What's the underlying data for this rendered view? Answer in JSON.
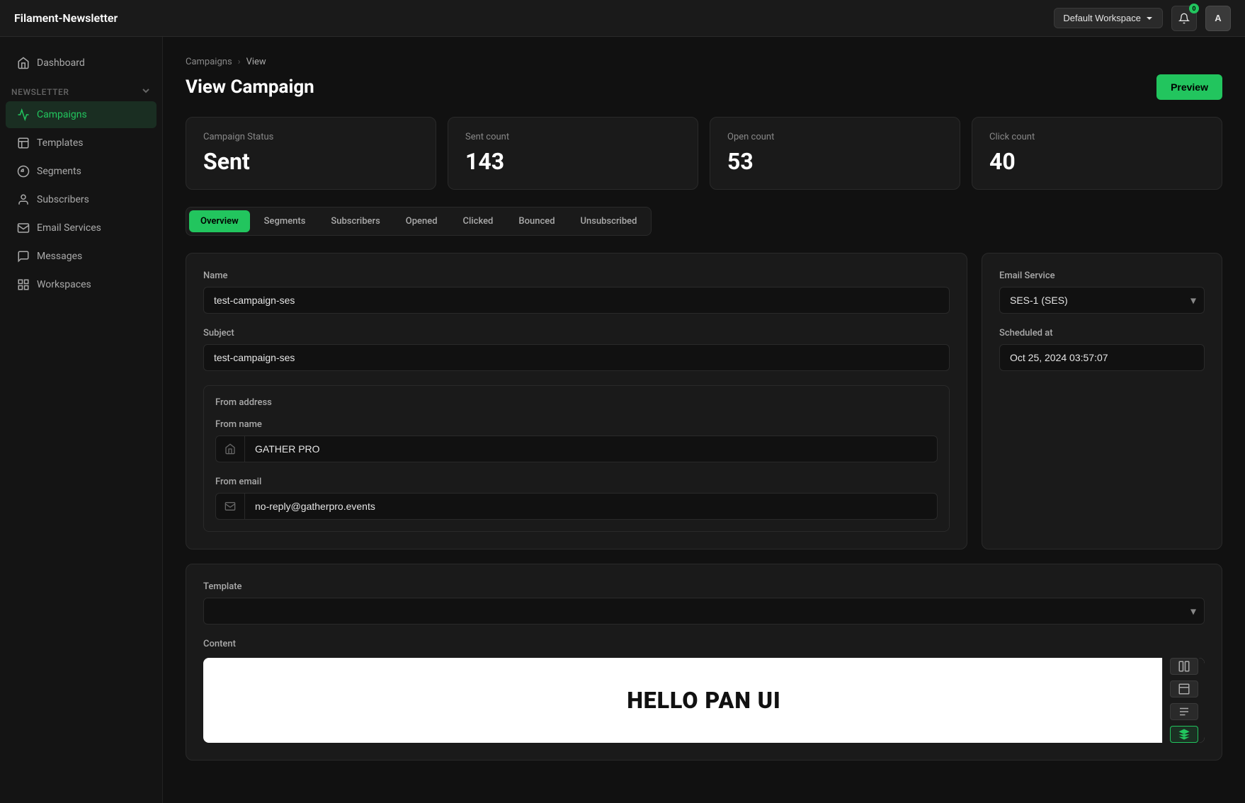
{
  "app": {
    "title": "Filament-Newsletter"
  },
  "topbar": {
    "workspace_label": "Default Workspace",
    "notification_count": "0",
    "avatar_label": "A"
  },
  "sidebar": {
    "section_label": "Newsletter",
    "items": [
      {
        "id": "dashboard",
        "label": "Dashboard",
        "icon": "home-icon",
        "active": false
      },
      {
        "id": "campaigns",
        "label": "Campaigns",
        "icon": "campaigns-icon",
        "active": true
      },
      {
        "id": "templates",
        "label": "Templates",
        "icon": "templates-icon",
        "active": false
      },
      {
        "id": "segments",
        "label": "Segments",
        "icon": "segments-icon",
        "active": false
      },
      {
        "id": "subscribers",
        "label": "Subscribers",
        "icon": "subscribers-icon",
        "active": false
      },
      {
        "id": "email-services",
        "label": "Email Services",
        "icon": "email-services-icon",
        "active": false
      },
      {
        "id": "messages",
        "label": "Messages",
        "icon": "messages-icon",
        "active": false
      },
      {
        "id": "workspaces",
        "label": "Workspaces",
        "icon": "workspaces-icon",
        "active": false
      }
    ]
  },
  "breadcrumb": {
    "parent": "Campaigns",
    "separator": "›",
    "current": "View"
  },
  "page": {
    "title": "View Campaign",
    "preview_button": "Preview"
  },
  "stats": [
    {
      "label": "Campaign Status",
      "value": "Sent"
    },
    {
      "label": "Sent count",
      "value": "143"
    },
    {
      "label": "Open count",
      "value": "53"
    },
    {
      "label": "Click count",
      "value": "40"
    }
  ],
  "tabs": [
    {
      "id": "overview",
      "label": "Overview",
      "active": true
    },
    {
      "id": "segments",
      "label": "Segments",
      "active": false
    },
    {
      "id": "subscribers",
      "label": "Subscribers",
      "active": false
    },
    {
      "id": "opened",
      "label": "Opened",
      "active": false
    },
    {
      "id": "clicked",
      "label": "Clicked",
      "active": false
    },
    {
      "id": "bounced",
      "label": "Bounced",
      "active": false
    },
    {
      "id": "unsubscribed",
      "label": "Unsubscribed",
      "active": false
    }
  ],
  "form": {
    "name_label": "Name",
    "name_value": "test-campaign-ses",
    "subject_label": "Subject",
    "subject_value": "test-campaign-ses",
    "from_address_label": "From address",
    "from_name_label": "From name",
    "from_name_value": "GATHER PRO",
    "from_email_label": "From email",
    "from_email_value": "no-reply@gatherpro.events",
    "email_service_label": "Email Service",
    "email_service_value": "SES-1 (SES)",
    "scheduled_at_label": "Scheduled at",
    "scheduled_at_value": "Oct 25, 2024 03:57:07",
    "template_label": "Template",
    "template_placeholder": "",
    "content_label": "Content",
    "content_preview_text": "HELLO PAN UI"
  }
}
